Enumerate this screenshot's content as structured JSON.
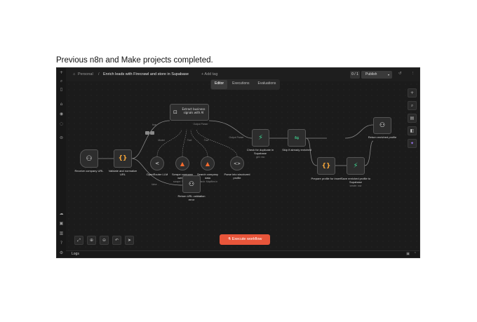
{
  "caption": "Previous n8n and Make projects completed.",
  "header": {
    "workspace": "Personal",
    "separator": "/",
    "workflow_title": "Enrich leads with Firecrawl and store in Supabase",
    "add_tag": "+ Add tag",
    "counter": "0 / 1",
    "publish": "Publish"
  },
  "tabs": [
    "Editor",
    "Executions",
    "Evaluations"
  ],
  "nodes": {
    "receive": {
      "label": "Receive company URL"
    },
    "validate": {
      "label1": "Validate and normalize",
      "label2": "URL"
    },
    "extract": {
      "label1": "Extract business",
      "label2": "signals with AI"
    },
    "openrouter": {
      "label": "OpenRouter LLM"
    },
    "scrape": {
      "label1": "Scrape company",
      "label2": "website",
      "sub": "scrape: Scrapling"
    },
    "search": {
      "label1": "Search company",
      "label2": "data",
      "sub": "search: Mapfiles in"
    },
    "parse": {
      "label1": "Parse into structured",
      "label2": "profile"
    },
    "check": {
      "label1": "Check for duplicate in",
      "label2": "Supabase",
      "sub": "get: row"
    },
    "skip": {
      "label": "Skip if already enriched"
    },
    "prepare": {
      "label": "Prepare profile for insert"
    },
    "save": {
      "label1": "Save enriched profile to",
      "label2": "Supabase",
      "sub": "create: row"
    },
    "return_profile": {
      "label": "Return enriched profile"
    },
    "return_error": {
      "label1": "Return URL validation",
      "label2": "error"
    }
  },
  "edge_labels": {
    "true": "true",
    "false": "false",
    "output_parser": "Output Parser",
    "model": "Model",
    "tool": "Tool"
  },
  "execute_button": "Execute workflow",
  "logs_label": "Logs"
}
